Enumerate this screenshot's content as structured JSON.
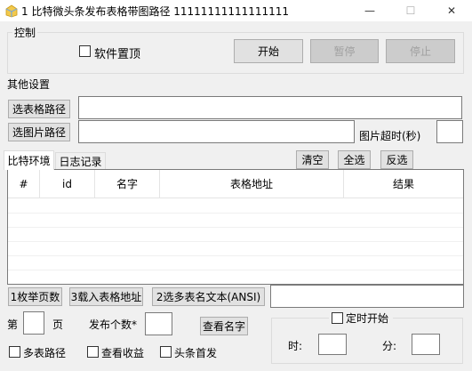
{
  "window": {
    "title": "1 比特微头条发布表格带图路径 11111111111111111",
    "minimize": "—",
    "maximize": "☐",
    "close": "✕"
  },
  "control": {
    "label": "控制",
    "pin_label": "软件置顶",
    "start": "开始",
    "pause": "暂停",
    "stop": "停止"
  },
  "settings": {
    "label": "其他设置",
    "choose_table_path": "选表格路径",
    "choose_image_path": "选图片路径",
    "table_path_value": "",
    "image_path_value": "",
    "image_timeout_label": "图片超时(秒)",
    "image_timeout_value": ""
  },
  "tabs": [
    {
      "label": "比特环境"
    },
    {
      "label": "日志记录"
    }
  ],
  "grid_actions": {
    "clear": "清空",
    "select_all": "全选",
    "invert": "反选"
  },
  "table": {
    "columns": [
      "#",
      "id",
      "名字",
      "表格地址",
      "结果"
    ],
    "rows": []
  },
  "bottom": {
    "enum_pages": "1枚举页数",
    "load_table_address": "3载入表格地址",
    "select_multi_table": "2选多表名文本(ANSI)",
    "multi_table_value": "",
    "page_prefix": "第",
    "page_suffix": "页",
    "page_value": "",
    "publish_count_label": "发布个数*",
    "publish_count_value": "",
    "view_names": "查看名字",
    "multi_table_path": "多表路径",
    "view_earnings": "查看收益",
    "headline_first": "头条首发",
    "timer_label": "定时开始",
    "hour_label": "时:",
    "hour_value": "",
    "minute_label": "分:",
    "minute_value": ""
  }
}
